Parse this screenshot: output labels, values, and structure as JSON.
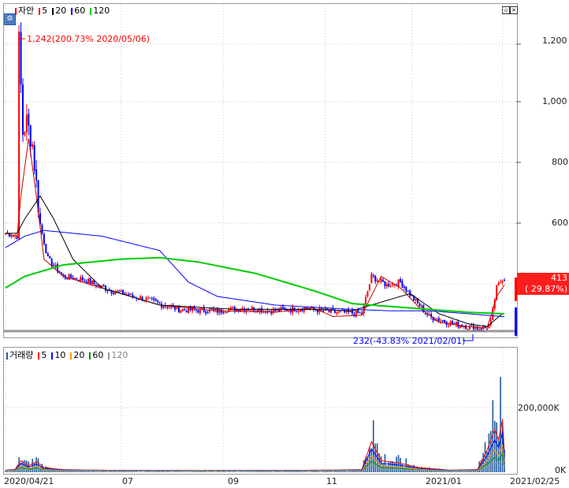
{
  "upper_panel": {
    "legend": {
      "name": "자안",
      "items": [
        {
          "label": "5",
          "color": "#ff0000"
        },
        {
          "label": "20",
          "color": "#000000"
        },
        {
          "label": "60",
          "color": "#0000ff"
        },
        {
          "label": "120",
          "color": "#00cc00"
        }
      ]
    },
    "max_annotation": "1,242(200.73% 2020/05/06)",
    "min_annotation": "232(-43.83% 2021/02/01)",
    "price_tag_value": "413",
    "price_tag_change": "( 29.87%)",
    "y_ticks": [
      "1,200",
      "1,000",
      "800",
      "600"
    ]
  },
  "lower_panel": {
    "legend": {
      "name": "거래량",
      "items": [
        {
          "label": "5",
          "color": "#ff0000"
        },
        {
          "label": "10",
          "color": "#0000ff"
        },
        {
          "label": "20",
          "color": "#ff9900"
        },
        {
          "label": "60",
          "color": "#009900"
        },
        {
          "label": "120",
          "color": "#999999"
        }
      ]
    },
    "y_ticks": [
      "200,000K",
      "0K"
    ]
  },
  "x_axis": {
    "labels": [
      "2020/04/21",
      "07",
      "09",
      "11",
      "2021/01",
      "2021/02/25"
    ]
  },
  "colors": {
    "up": "#ff0000",
    "down": "#0000ff",
    "ma5": "#cc0000",
    "ma20": "#000000",
    "ma60": "#0000ff",
    "ma120": "#00cc00",
    "grid": "#c8c8c8",
    "reference_line": "#999999",
    "volume_bar": "#1e5aa0"
  },
  "chart_data": [
    {
      "type": "candlestick",
      "title": "자안",
      "x_range": [
        "2020/04/21",
        "2021/02/25"
      ],
      "ylim": [
        232,
        1300
      ],
      "y_ticks": [
        600,
        800,
        1000,
        1200
      ],
      "grid": true,
      "legend_position": "top-left",
      "annotations": [
        {
          "date": "2020/05/06",
          "value": 1242,
          "text": "1,242(200.73% 2020/05/06)"
        },
        {
          "date": "2021/02/01",
          "value": 232,
          "text": "232(-43.83% 2021/02/01)"
        }
      ],
      "last_price": 413,
      "last_change_pct": 29.87,
      "series": [
        {
          "name": "5",
          "approx_path": [
            [
              0,
              570
            ],
            [
              6,
              560
            ],
            [
              8,
              700
            ],
            [
              12,
              900
            ],
            [
              16,
              700
            ],
            [
              20,
              480
            ],
            [
              30,
              420
            ],
            [
              50,
              380
            ],
            [
              80,
              320
            ],
            [
              110,
              300
            ],
            [
              140,
              295
            ],
            [
              160,
              310
            ],
            [
              170,
              280
            ],
            [
              185,
              285
            ],
            [
              195,
              420
            ],
            [
              205,
              380
            ],
            [
              215,
              310
            ],
            [
              225,
              260
            ],
            [
              240,
              245
            ],
            [
              250,
              240
            ],
            [
              255,
              350
            ],
            [
              260,
              400
            ]
          ]
        },
        {
          "name": "20",
          "approx_path": [
            [
              0,
              570
            ],
            [
              6,
              570
            ],
            [
              10,
              620
            ],
            [
              18,
              700
            ],
            [
              25,
              620
            ],
            [
              35,
              480
            ],
            [
              50,
              380
            ],
            [
              80,
              320
            ],
            [
              120,
              305
            ],
            [
              160,
              305
            ],
            [
              180,
              300
            ],
            [
              195,
              330
            ],
            [
              210,
              360
            ],
            [
              225,
              290
            ],
            [
              240,
              255
            ],
            [
              250,
              245
            ],
            [
              258,
              290
            ]
          ]
        },
        {
          "name": "60",
          "approx_path": [
            [
              0,
              520
            ],
            [
              10,
              560
            ],
            [
              20,
              580
            ],
            [
              50,
              560
            ],
            [
              80,
              510
            ],
            [
              95,
              400
            ],
            [
              110,
              350
            ],
            [
              140,
              320
            ],
            [
              180,
              305
            ],
            [
              200,
              300
            ],
            [
              220,
              300
            ],
            [
              240,
              290
            ],
            [
              258,
              280
            ]
          ]
        },
        {
          "name": "120",
          "approx_path": [
            [
              0,
              380
            ],
            [
              10,
              420
            ],
            [
              30,
              460
            ],
            [
              60,
              480
            ],
            [
              80,
              485
            ],
            [
              100,
              470
            ],
            [
              130,
              430
            ],
            [
              160,
              370
            ],
            [
              180,
              325
            ],
            [
              210,
              310
            ],
            [
              240,
              295
            ],
            [
              258,
              290
            ]
          ]
        }
      ]
    },
    {
      "type": "bar",
      "title": "거래량",
      "x_range": [
        "2020/04/21",
        "2021/02/25"
      ],
      "ylim": [
        0,
        380000
      ],
      "y_ticks": [
        0,
        200000
      ],
      "y_unit": "K",
      "series": [
        {
          "name": "5"
        },
        {
          "name": "10"
        },
        {
          "name": "20"
        },
        {
          "name": "60"
        },
        {
          "name": "120"
        }
      ]
    }
  ]
}
